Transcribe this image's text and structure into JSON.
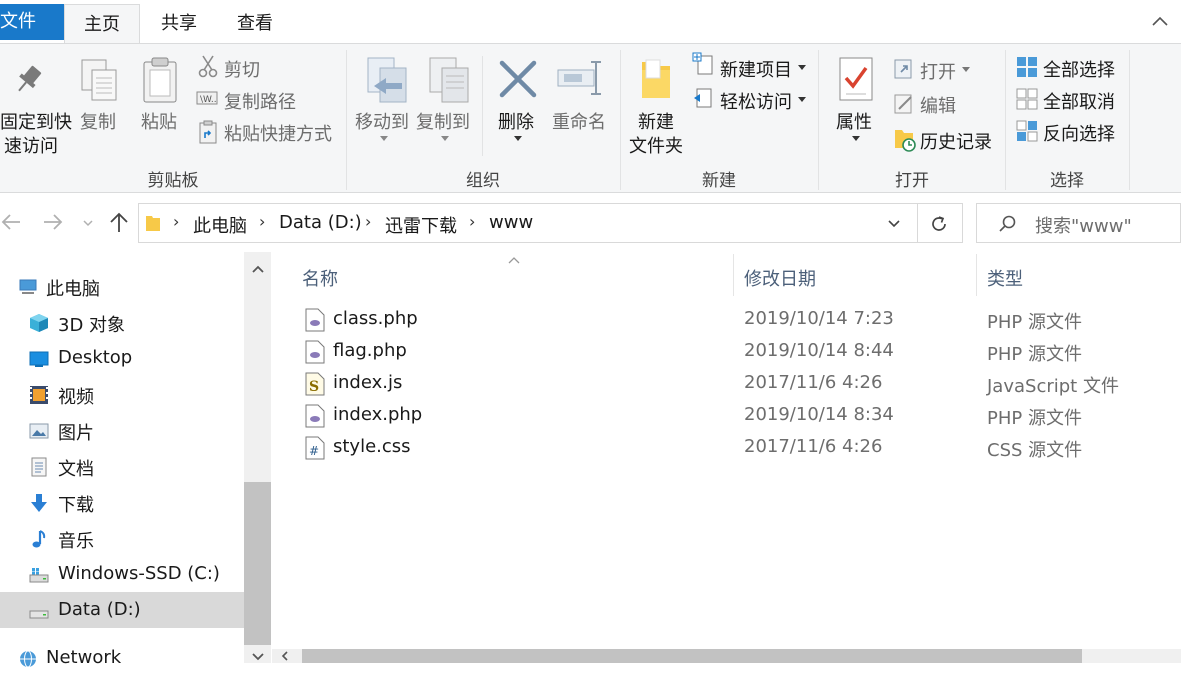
{
  "tabs": {
    "file": "文件",
    "home": "主页",
    "share": "共享",
    "view": "查看"
  },
  "ribbon": {
    "clipboard": {
      "pin_line1": "固定到快",
      "pin_line2": "速访问",
      "copy": "复制",
      "paste": "粘贴",
      "cut": "剪切",
      "copy_path": "复制路径",
      "paste_shortcut": "粘贴快捷方式",
      "group": "剪贴板"
    },
    "organize": {
      "move_to": "移动到",
      "copy_to": "复制到",
      "delete": "删除",
      "rename": "重命名",
      "group": "组织"
    },
    "new": {
      "new_folder_line1": "新建",
      "new_folder_line2": "文件夹",
      "new_item": "新建项目",
      "easy_access": "轻松访问",
      "group": "新建"
    },
    "open": {
      "properties": "属性",
      "open": "打开",
      "edit": "编辑",
      "history": "历史记录",
      "group": "打开"
    },
    "select": {
      "select_all": "全部选择",
      "select_none": "全部取消",
      "invert": "反向选择",
      "group": "选择"
    }
  },
  "address": {
    "crumbs": [
      "此电脑",
      "Data (D:)",
      "迅雷下载",
      "www"
    ],
    "search_placeholder": "搜索\"www\""
  },
  "nav": {
    "items": [
      {
        "label": "此电脑",
        "icon": "computer-icon"
      },
      {
        "label": "3D 对象",
        "icon": "cube-3d-icon"
      },
      {
        "label": "Desktop",
        "icon": "desktop-icon"
      },
      {
        "label": "视频",
        "icon": "video-icon"
      },
      {
        "label": "图片",
        "icon": "picture-icon"
      },
      {
        "label": "文档",
        "icon": "document-icon"
      },
      {
        "label": "下载",
        "icon": "download-icon"
      },
      {
        "label": "音乐",
        "icon": "music-icon"
      },
      {
        "label": "Windows-SSD (C:)",
        "icon": "drive-c-icon"
      },
      {
        "label": "Data (D:)",
        "icon": "drive-d-icon"
      },
      {
        "label": "Network",
        "icon": "network-icon"
      }
    ]
  },
  "files": {
    "headers": {
      "name": "名称",
      "date": "修改日期",
      "type": "类型"
    },
    "rows": [
      {
        "name": "class.php",
        "date": "2019/10/14 7:23",
        "type": "PHP 源文件",
        "icon": "php-file-icon"
      },
      {
        "name": "flag.php",
        "date": "2019/10/14 8:44",
        "type": "PHP 源文件",
        "icon": "php-file-icon"
      },
      {
        "name": "index.js",
        "date": "2017/11/6 4:26",
        "type": "JavaScript 文件",
        "icon": "js-file-icon"
      },
      {
        "name": "index.php",
        "date": "2019/10/14 8:34",
        "type": "PHP 源文件",
        "icon": "php-file-icon"
      },
      {
        "name": "style.css",
        "date": "2017/11/6 4:26",
        "type": "CSS 源文件",
        "icon": "css-file-icon"
      }
    ]
  },
  "colors": {
    "accent": "#1979ca",
    "selection": "#d9d9d9",
    "header_text": "#4c607a"
  }
}
